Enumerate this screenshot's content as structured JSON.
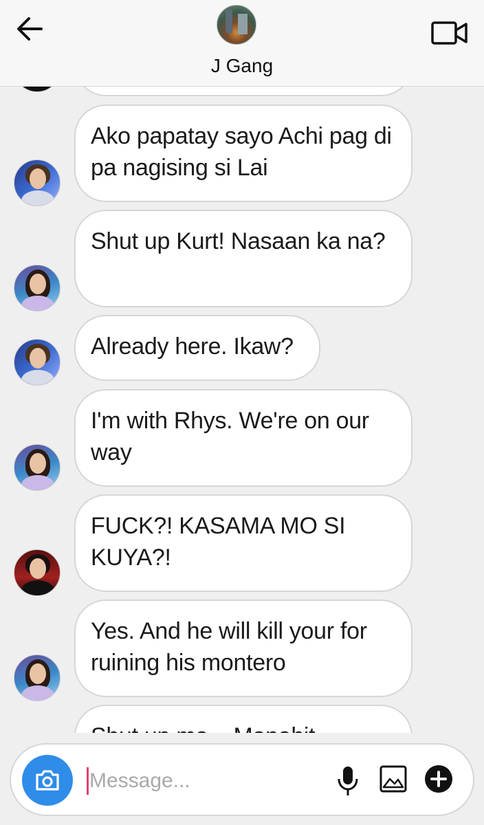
{
  "header": {
    "title": "J Gang",
    "back_icon": "arrow-left-icon",
    "video_icon": "video-camera-icon"
  },
  "messages": [
    {
      "sender": "kurt",
      "text": "Ako papatay sayo Achi pag di pa nagising si Lai"
    },
    {
      "sender": "achi",
      "text": "Shut up Kurt! Nasaan ka na?"
    },
    {
      "sender": "kurt",
      "text": "Already here. Ikaw?"
    },
    {
      "sender": "achi",
      "text": "I'm with Rhys. We're on our way"
    },
    {
      "sender": "rhys",
      "text": "FUCK?! KASAMA MO SI KUYA?!"
    },
    {
      "sender": "achi",
      "text": "Yes. And he will kill your for ruining his montero"
    },
    {
      "sender": "kurt",
      "text": "Shut up ma... Mapahit..."
    }
  ],
  "composer": {
    "placeholder": "Message...",
    "value": "",
    "camera_icon": "camera-icon",
    "mic_icon": "microphone-icon",
    "image_icon": "image-icon",
    "plus_icon": "plus-circle-icon"
  },
  "colors": {
    "accent": "#2f8ce8",
    "background": "#efefef",
    "bubble": "#ffffff",
    "bubble_border": "#d6d6d6",
    "caret": "#e0406e"
  }
}
